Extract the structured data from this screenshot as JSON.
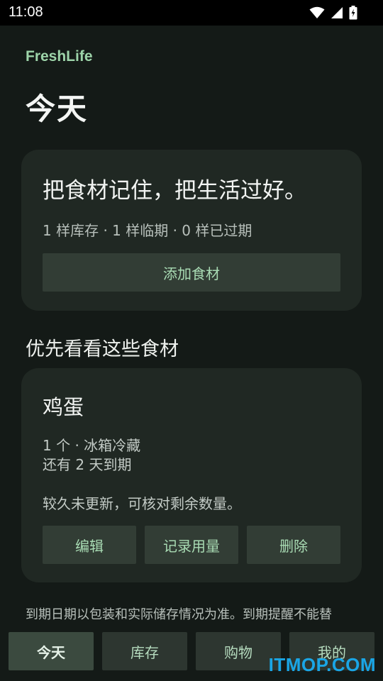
{
  "status_bar": {
    "time": "11:08",
    "icons": [
      "wifi-icon",
      "signal-icon",
      "battery-charging-icon"
    ]
  },
  "app": {
    "brand": "FreshLife",
    "page_title": "今天"
  },
  "hero": {
    "title": "把食材记住，把生活过好。",
    "stats": "1 样库存 · 1 样临期 · 0 样已过期",
    "add_button": "添加食材"
  },
  "priority": {
    "heading": "优先看看这些食材",
    "item": {
      "name": "鸡蛋",
      "meta_line1": "1 个 · 冰箱冷藏",
      "meta_line2": "还有 2 天到期",
      "note": "较久未更新，可核对剩余数量。",
      "actions": {
        "edit": "编辑",
        "record": "记录用量",
        "delete": "删除"
      }
    }
  },
  "disclaimer": "到期日期以包装和实际储存情况为准。到期提醒不能替",
  "nav": {
    "tabs": [
      "今天",
      "库存",
      "购物",
      "我的"
    ],
    "active_index": 0
  },
  "watermark": "ITMOP.COM",
  "colors": {
    "background": "#141a17",
    "card": "#202823",
    "accent": "#9dd4a9",
    "button": "#323d35"
  }
}
